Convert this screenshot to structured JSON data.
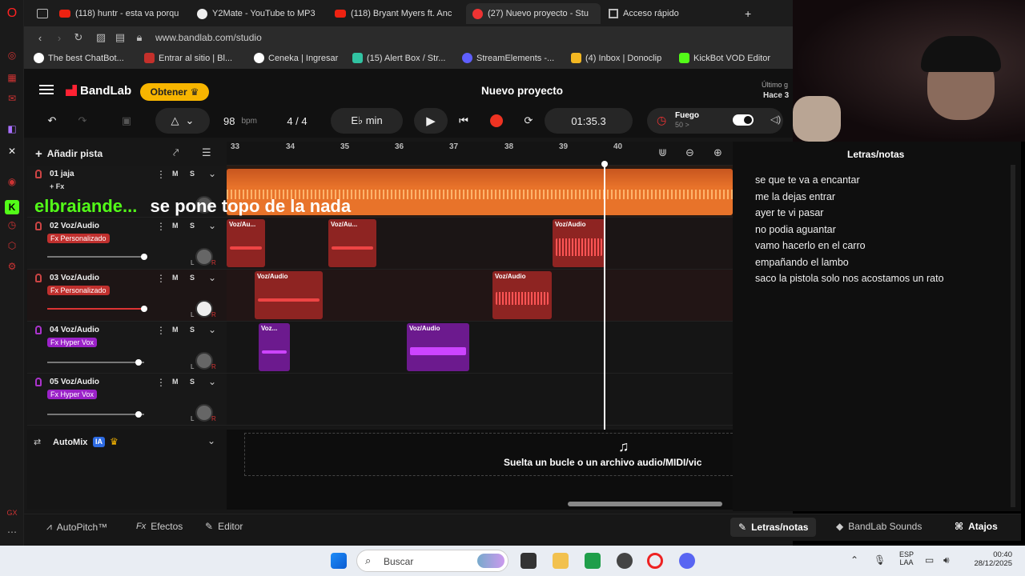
{
  "tabs": [
    {
      "label": "(118) huntr - esta va porqu",
      "icon": "youtube-icon"
    },
    {
      "label": "Y2Mate - YouTube to MP3",
      "icon": "y2mate-icon"
    },
    {
      "label": "(118) Bryant Myers ft. Anc",
      "icon": "youtube-icon"
    },
    {
      "label": "(27) Nuevo proyecto - Stu",
      "icon": "bandlab-icon"
    },
    {
      "label": "Acceso rápido",
      "icon": "grid-icon"
    }
  ],
  "new_tab": "+",
  "address": {
    "url": "www.bandlab.com/studio"
  },
  "bookmarks": [
    {
      "label": "The best ChatBot...",
      "color": "#ffffff"
    },
    {
      "label": "Entrar al sitio | Bl...",
      "color": "#c4302b"
    },
    {
      "label": "Ceneka | Ingresar",
      "color": "#ffffff"
    },
    {
      "label": "(15) Alert Box / Str...",
      "color": "#31c3a2"
    },
    {
      "label": "StreamElements -...",
      "color": "#5f5fff"
    },
    {
      "label": "(4) Inbox | Donoclip",
      "color": "#f2b722"
    },
    {
      "label": "KickBot VOD Editor",
      "color": "#53fc18"
    }
  ],
  "app": {
    "brand": "BandLab",
    "obtener": "Obtener",
    "project_title": "Nuevo proyecto",
    "last_save_label": "Último g",
    "last_save_time": "Hace 3"
  },
  "transport": {
    "bpm": "98",
    "bpm_unit": "bpm",
    "time_sig": "4 / 4",
    "key": "E♭ min",
    "time": "01:35.3",
    "preset_name": "Fuego",
    "preset_value": "50 >"
  },
  "toolbar": {
    "add_track": "Añadir pista"
  },
  "ruler": [
    "33",
    "34",
    "35",
    "36",
    "37",
    "38",
    "39",
    "40"
  ],
  "tracks": [
    {
      "number_name": "01  jaja",
      "fx": "+ Fx",
      "color": "#e8732a",
      "mic_color": "#c44",
      "volume": 0.0,
      "has_controls": false
    },
    {
      "number_name": "02  Voz/Audio",
      "fx": "Fx  Personalizado",
      "color": "#c0302e",
      "mic_color": "#c44",
      "volume": 1.0,
      "has_controls": true
    },
    {
      "number_name": "03  Voz/Audio",
      "fx": "Fx  Personalizado",
      "color": "#c0302e",
      "mic_color": "#c44",
      "volume": 1.0,
      "has_controls": true
    },
    {
      "number_name": "04  Voz/Audio",
      "fx": "Fx  Hyper Vox",
      "color": "#9b22c8",
      "mic_color": "#a3c",
      "volume": 0.94,
      "has_controls": true
    },
    {
      "number_name": "05  Voz/Audio",
      "fx": "Fx  Hyper Vox",
      "color": "#9b22c8",
      "mic_color": "#a3c",
      "volume": 0.94,
      "has_controls": true
    }
  ],
  "clips": {
    "track2": [
      {
        "label": "Voz/Au..."
      },
      {
        "label": "Voz/Au..."
      },
      {
        "label": "Voz/Audio"
      }
    ],
    "track3": [
      {
        "label": "Voz/Audio"
      },
      {
        "label": "Voz/Audio"
      }
    ],
    "track4": [
      {
        "label": "Voz..."
      },
      {
        "label": "Voz/Audio"
      }
    ]
  },
  "track_buttons": {
    "mute": "M",
    "solo": "S",
    "left": "L",
    "right": "R"
  },
  "automix": {
    "label": "AutoMix",
    "badge": "IA"
  },
  "drop_hint": "Suelta un bucle o un archivo audio/MIDI/vic",
  "overlay": {
    "username": "elbraiande...",
    "caption": "se pone topo de la nada"
  },
  "lyrics_panel": {
    "title": "Letras/notas",
    "lines": [
      "se que te va a encantar",
      "me la dejas  entrar",
      "ayer te vi pasar",
      "no podia aguantar",
      "vamo hacerlo en el carro",
      "empañando el lambo",
      "saco la pistola solo nos acostamos un rato"
    ]
  },
  "footer": {
    "autopitch": "AutoPitch™",
    "efectos": "Efectos",
    "editor": "Editor",
    "letras": "Letras/notas",
    "sounds": "BandLab Sounds",
    "atajos": "Atajos",
    "fx_prefix": "Fx"
  },
  "taskbar": {
    "search": "Buscar",
    "lang_top": "ESP",
    "lang_bottom": "LAA",
    "time": "00:40",
    "date": "28/12/2025"
  }
}
